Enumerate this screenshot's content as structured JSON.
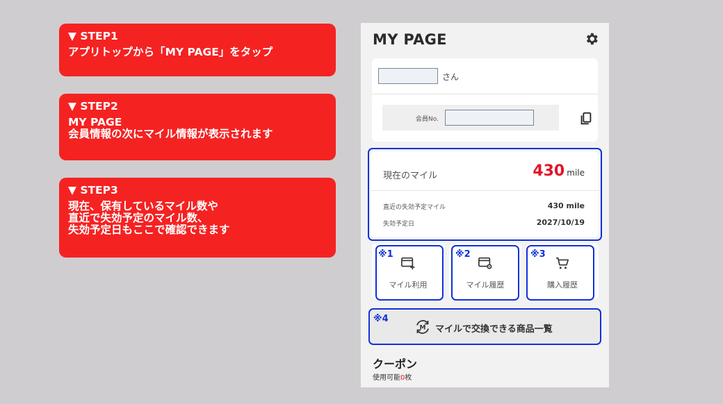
{
  "steps": [
    {
      "head": "▼ STEP1",
      "lines": [
        "アプリトップから「MY PAGE」をタップ"
      ]
    },
    {
      "head": "▼ STEP2",
      "lines": [
        "MY PAGE",
        "会員情報の次にマイル情報が表示されます"
      ]
    },
    {
      "head": "▼ STEP3",
      "lines": [
        "現在、保有しているマイル数や",
        "直近で失効予定のマイル数、",
        "失効予定日もここで確認できます"
      ]
    }
  ],
  "mypage": {
    "title": "MY PAGE",
    "san": "さん",
    "member_no_label": "会員No.",
    "current_mile_label": "現在のマイル",
    "current_mile_value": "430",
    "mile_unit": "mile",
    "expiring_label": "直近の失効予定マイル",
    "expiring_value": "430 mile",
    "expiry_date_label": "失効予定日",
    "expiry_date_value": "2027/10/19",
    "tiles": [
      {
        "label": "マイル利用",
        "note": "※1",
        "icon": "card-plus-icon"
      },
      {
        "label": "マイル履歴",
        "note": "※2",
        "icon": "card-gear-icon"
      },
      {
        "label": "購入履歴",
        "note": "※3",
        "icon": "cart-icon"
      }
    ],
    "exchange_label": "マイルで交換できる商品一覧",
    "exchange_note": "※4",
    "coupon_title": "クーポン",
    "coupon_prefix": "使用可能",
    "coupon_count": "0",
    "coupon_suffix": "枚"
  },
  "colors": {
    "step_bg": "#f52222",
    "highlight": "#1030d8",
    "mile_red": "#e1162a"
  }
}
